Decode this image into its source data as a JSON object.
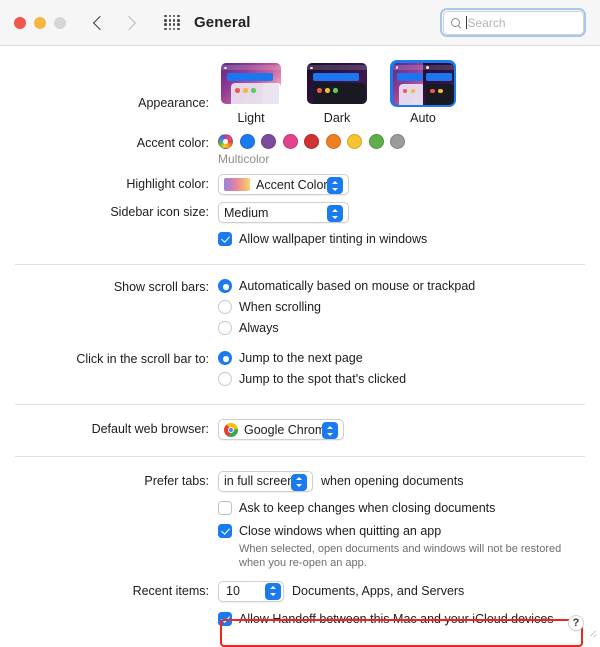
{
  "window": {
    "title": "General",
    "traffic_lights": [
      "close",
      "minimize",
      "zoom"
    ],
    "back_label": "Back",
    "forward_label": "Forward",
    "grid_label": "Show All"
  },
  "search": {
    "placeholder": "Search",
    "value": ""
  },
  "appearance": {
    "label": "Appearance:",
    "options": [
      {
        "label": "Light",
        "selected": false
      },
      {
        "label": "Dark",
        "selected": false
      },
      {
        "label": "Auto",
        "selected": true
      }
    ]
  },
  "accent_color": {
    "label": "Accent color:",
    "caption": "Multicolor",
    "selected": "Multicolor",
    "swatches": [
      {
        "name": "Multicolor",
        "color": "multicolor"
      },
      {
        "name": "Blue",
        "color": "#1a7bf0"
      },
      {
        "name": "Purple",
        "color": "#7c4b9e"
      },
      {
        "name": "Pink",
        "color": "#e2438c"
      },
      {
        "name": "Red",
        "color": "#cf3232"
      },
      {
        "name": "Orange",
        "color": "#ef8021"
      },
      {
        "name": "Yellow",
        "color": "#f5c431"
      },
      {
        "name": "Green",
        "color": "#5fad4b"
      },
      {
        "name": "Graphite",
        "color": "#9b9b9b"
      }
    ]
  },
  "highlight_color": {
    "label": "Highlight color:",
    "value": "Accent Color"
  },
  "sidebar_icon_size": {
    "label": "Sidebar icon size:",
    "value": "Medium"
  },
  "wallpaper_tinting": {
    "label": "Allow wallpaper tinting in windows",
    "checked": true
  },
  "show_scroll_bars": {
    "label": "Show scroll bars:",
    "options": [
      {
        "label": "Automatically based on mouse or trackpad",
        "selected": true
      },
      {
        "label": "When scrolling",
        "selected": false
      },
      {
        "label": "Always",
        "selected": false
      }
    ]
  },
  "click_scroll_bar": {
    "label": "Click in the scroll bar to:",
    "options": [
      {
        "label": "Jump to the next page",
        "selected": true
      },
      {
        "label": "Jump to the spot that's clicked",
        "selected": false
      }
    ]
  },
  "default_web_browser": {
    "label": "Default web browser:",
    "value": "Google Chrome"
  },
  "prefer_tabs": {
    "label": "Prefer tabs:",
    "value": "in full screen",
    "trailing": "when opening documents"
  },
  "ask_keep_changes": {
    "label": "Ask to keep changes when closing documents",
    "checked": false
  },
  "close_windows": {
    "label": "Close windows when quitting an app",
    "checked": true,
    "help": "When selected, open documents and windows will not be restored when you re-open an app."
  },
  "recent_items": {
    "label": "Recent items:",
    "value": "10",
    "trailing": "Documents, Apps, and Servers"
  },
  "handoff": {
    "label": "Allow Handoff between this Mac and your iCloud devices",
    "checked": true,
    "highlight_color": "#f0261c"
  },
  "help_button": {
    "label": "?"
  }
}
